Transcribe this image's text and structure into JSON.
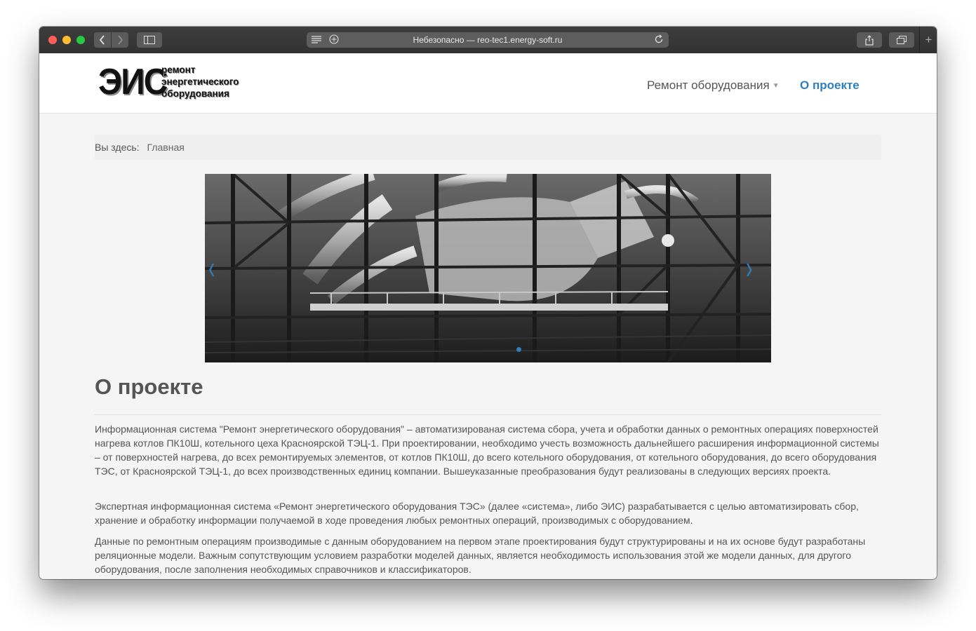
{
  "browser": {
    "address": "Небезопасно — reo-tec1.energy-soft.ru",
    "new_tab_symbol": "+"
  },
  "logo": {
    "mark": "ЭИС",
    "line1": "ремонт",
    "line2": "энергетического",
    "line3": "оборудования"
  },
  "nav": {
    "items": [
      {
        "label": "Ремонт оборудования",
        "has_dropdown": true
      },
      {
        "label": "О проекте",
        "active": true
      }
    ],
    "active_color": "#2f7fc0"
  },
  "breadcrumb": {
    "label": "Вы здесь:",
    "home": "Главная"
  },
  "slider": {
    "prev_symbol": "‹",
    "next_symbol": "›",
    "active_slide": 1
  },
  "page": {
    "title": "О проекте",
    "paragraphs": [
      "Информационная система \"Ремонт энергетического оборудования\" – автоматизированая система сбора, учета и обработки данных о ремонтных операциях поверхностей нагрева котлов ПК10Ш, котельного цеха Красноярской ТЭЦ-1. При проектировании, необходимо учесть возможность дальнейшего расширения информационной системы – от поверхностей нагрева, до всех ремонтируемых элементов, от котлов ПК10Ш, до всего котельного оборудования, от котельного оборудования, до всего оборудования ТЭС, от Красноярской ТЭЦ-1, до всех производственных единиц компании.  Вышеуказанные преобразования будут реализованы в следующих версиях проекта.",
      "Экспертная информационная система «Ремонт энергетического оборудования ТЭС» (далее «система», либо ЭИС) разрабатывается с целью автоматизировать сбор, хранение и обработку информации получаемой в ходе проведения любых ремонтных операций, производимых с оборудованием.",
      "Данные по ремонтным операциям производимые с данным оборудованием на первом этапе проектирования будут структурированы и на их основе будут разработаны реляционные модели. Важным сопутствующим условием разработки моделей данных, является необходимость использования этой же модели данных, для другого оборудования, после заполнения необходимых справочников и классификаторов."
    ]
  }
}
